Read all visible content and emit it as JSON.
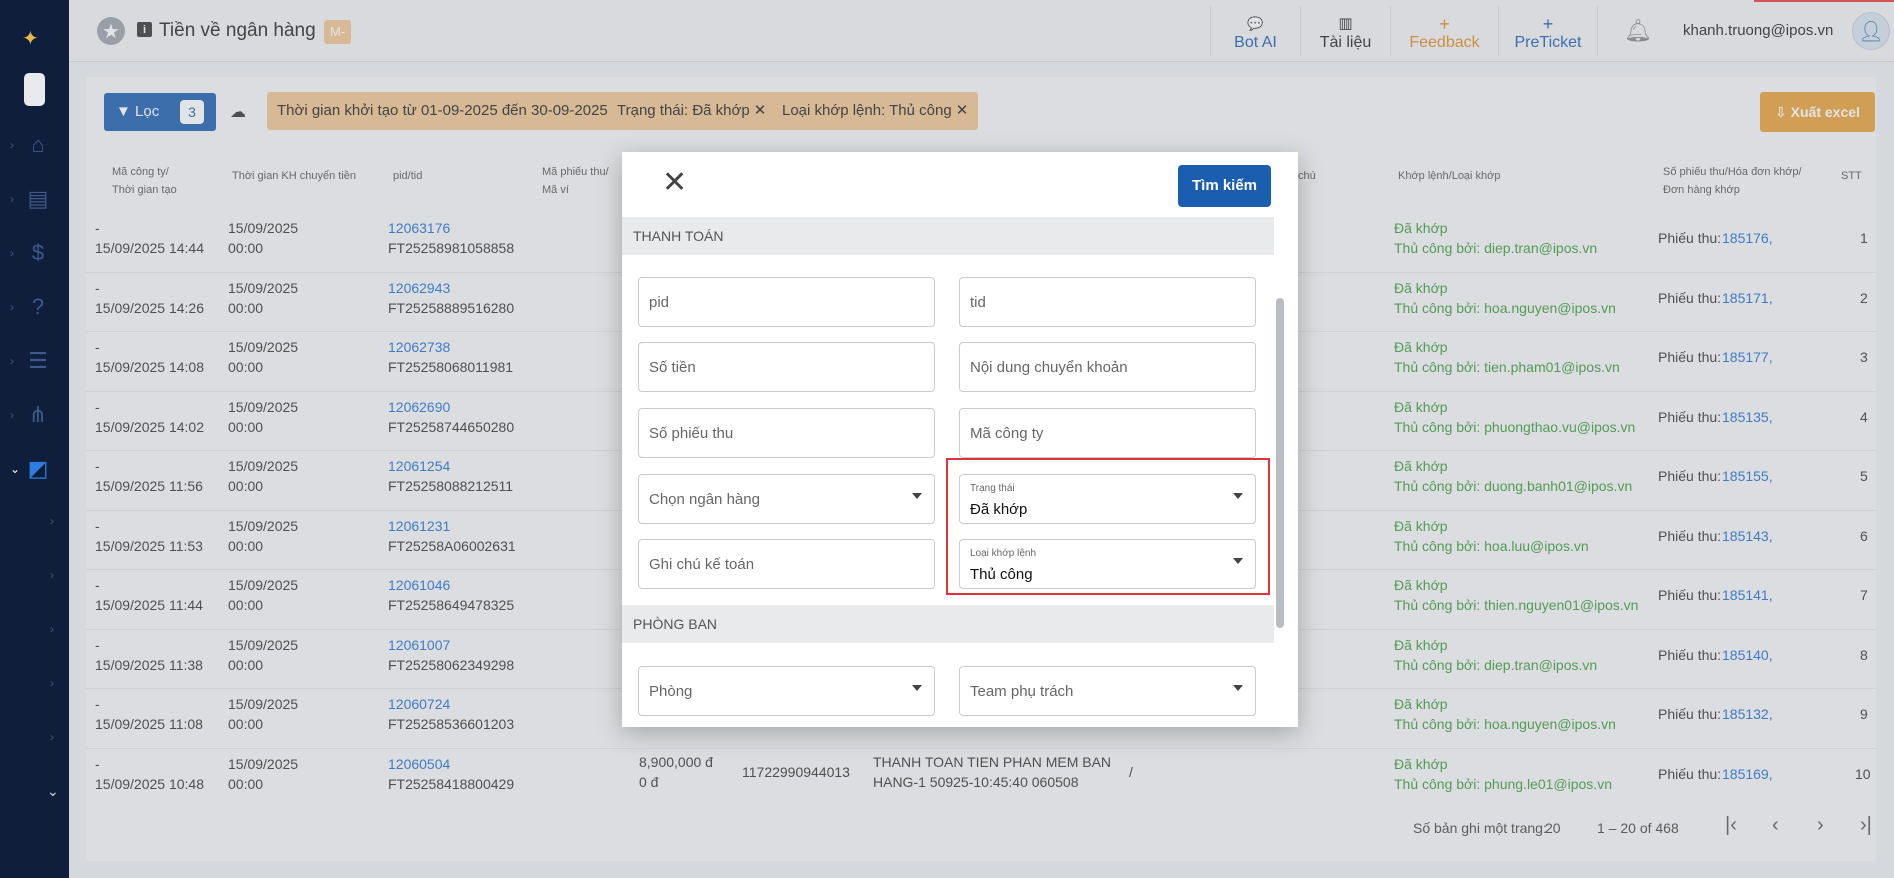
{
  "sidebar": {
    "items": [
      {
        "icon": "home-icon",
        "glyph": "⌂"
      },
      {
        "icon": "chart-icon",
        "glyph": "▤"
      },
      {
        "icon": "dollar-icon",
        "glyph": "$"
      },
      {
        "icon": "help-icon",
        "glyph": "?"
      },
      {
        "icon": "list-icon",
        "glyph": "☰"
      },
      {
        "icon": "network-icon",
        "glyph": "⋔"
      },
      {
        "icon": "report-icon",
        "glyph": "◩"
      }
    ]
  },
  "header": {
    "title": "Tiền về ngân hàng",
    "tag": "M-",
    "nav": [
      {
        "icon": "chat-icon",
        "glyph": "💬",
        "label": "Bot AI",
        "color": "#1b5eb0"
      },
      {
        "icon": "book-icon",
        "glyph": "▥",
        "label": "Tài liệu",
        "color": "#222222"
      },
      {
        "icon": "plus-icon",
        "glyph": "+",
        "label": "Feedback",
        "color": "#e08a1e"
      },
      {
        "icon": "plus-icon",
        "glyph": "+",
        "label": "PreTicket",
        "color": "#1b5eb0"
      }
    ],
    "user_email": "khanh.truong@ipos.vn"
  },
  "toolbar": {
    "filter_label": "Lọc",
    "filter_count": "3",
    "chips": [
      "Thời gian khởi tạo từ 01-09-2025 đến 30-09-2025",
      "Trạng thái: Đã khớp",
      "Loại khớp lệnh: Thủ công"
    ],
    "export_label": "Xuất excel"
  },
  "table": {
    "headers": {
      "company": [
        "Mã công ty/",
        "Thời gian tạo"
      ],
      "transfer_time": "Thời gian KH chuyển tiền",
      "pid": "pid/tid",
      "receipt": [
        "Mã phiếu thu/",
        "Mã ví"
      ],
      "note": "chú",
      "match": "Khớp lệnh/Loại khớp",
      "invoice": [
        "Số phiếu thu/Hóa đơn khớp/",
        "Đơn hàng khớp"
      ],
      "stt": "STT"
    },
    "rows": [
      {
        "c1": "-",
        "c2": "15/09/2025 14:44",
        "t1": "15/09/2025",
        "t2": "00:00",
        "pid": "12063176",
        "tid": "FT25258981058858",
        "m1": "Đã khớp",
        "m2": "Thủ công bởi: diep.tran@ipos.vn",
        "inv_label": "Phiếu thu:",
        "inv": "185176,",
        "stt": "1"
      },
      {
        "c1": "-",
        "c2": "15/09/2025 14:26",
        "t1": "15/09/2025",
        "t2": "00:00",
        "pid": "12062943",
        "tid": "FT25258889516280",
        "m1": "Đã khớp",
        "m2": "Thủ công bởi: hoa.nguyen@ipos.vn",
        "inv_label": "Phiếu thu:",
        "inv": "185171,",
        "stt": "2"
      },
      {
        "c1": "-",
        "c2": "15/09/2025 14:08",
        "t1": "15/09/2025",
        "t2": "00:00",
        "pid": "12062738",
        "tid": "FT25258068011981",
        "m1": "Đã khớp",
        "m2": "Thủ công bởi: tien.pham01@ipos.vn",
        "inv_label": "Phiếu thu:",
        "inv": "185177,",
        "stt": "3"
      },
      {
        "c1": "-",
        "c2": "15/09/2025 14:02",
        "t1": "15/09/2025",
        "t2": "00:00",
        "pid": "12062690",
        "tid": "FT25258744650280",
        "m1": "Đã khớp",
        "m2": "Thủ công bởi: phuongthao.vu@ipos.vn",
        "inv_label": "Phiếu thu:",
        "inv": "185135,",
        "stt": "4"
      },
      {
        "c1": "-",
        "c2": "15/09/2025 11:56",
        "t1": "15/09/2025",
        "t2": "00:00",
        "pid": "12061254",
        "tid": "FT25258088212511",
        "m1": "Đã khớp",
        "m2": "Thủ công bởi: duong.banh01@ipos.vn",
        "inv_label": "Phiếu thu:",
        "inv": "185155,",
        "stt": "5"
      },
      {
        "c1": "-",
        "c2": "15/09/2025 11:53",
        "t1": "15/09/2025",
        "t2": "00:00",
        "pid": "12061231",
        "tid": "FT25258A06002631",
        "m1": "Đã khớp",
        "m2": "Thủ công bởi: hoa.luu@ipos.vn",
        "inv_label": "Phiếu thu:",
        "inv": "185143,",
        "stt": "6"
      },
      {
        "c1": "-",
        "c2": "15/09/2025 11:44",
        "t1": "15/09/2025",
        "t2": "00:00",
        "pid": "12061046",
        "tid": "FT25258649478325",
        "m1": "Đã khớp",
        "m2": "Thủ công bởi: thien.nguyen01@ipos.vn",
        "inv_label": "Phiếu thu:",
        "inv": "185141,",
        "stt": "7"
      },
      {
        "c1": "-",
        "c2": "15/09/2025 11:38",
        "t1": "15/09/2025",
        "t2": "00:00",
        "pid": "12061007",
        "tid": "FT25258062349298",
        "m1": "Đã khớp",
        "m2": "Thủ công bởi: diep.tran@ipos.vn",
        "inv_label": "Phiếu thu:",
        "inv": "185140,",
        "stt": "8"
      },
      {
        "c1": "-",
        "c2": "15/09/2025 11:08",
        "t1": "15/09/2025",
        "t2": "00:00",
        "pid": "12060724",
        "tid": "FT25258536601203",
        "m1": "Đã khớp",
        "m2": "Thủ công bởi: hoa.nguyen@ipos.vn",
        "inv_label": "Phiếu thu:",
        "inv": "185132,",
        "stt": "9"
      },
      {
        "c1": "-",
        "c2": "15/09/2025 10:48",
        "t1": "15/09/2025",
        "t2": "00:00",
        "pid": "12060504",
        "tid": "FT25258418800429",
        "m1": "Đã khớp",
        "m2": "Thủ công bởi: phung.le01@ipos.vn",
        "inv_label": "Phiếu thu:",
        "inv": "185169,",
        "stt": "10"
      }
    ],
    "row10_extra": {
      "amount": "8,900,000 đ",
      "fee": "0 đ",
      "account": "11722990944013",
      "content_1": "THANH TOAN TIEN PHAN MEM BAN",
      "content_2": "HANG-1 50925-10:45:40 060508",
      "slash": "/"
    }
  },
  "pager": {
    "per_page_label": "Số bản ghi một trang:",
    "per_page": "20",
    "range": "1 – 20 of 468"
  },
  "modal": {
    "search_label": "Tìm kiếm",
    "section_payment": "THANH TOÁN",
    "section_dept": "PHÒNG BAN",
    "fields": {
      "pid": "pid",
      "tid": "tid",
      "amount": "Số tiền",
      "transfer_content": "Nội dung chuyển khoản",
      "receipt_no": "Số phiếu thu",
      "company_code": "Mã công ty",
      "bank": "Chọn ngân hàng",
      "status_label": "Trạng thái",
      "status_value": "Đã khớp",
      "accounting_note": "Ghi chú kế toán",
      "match_type_label": "Loại khớp lệnh",
      "match_type_value": "Thủ công",
      "department": "Phòng",
      "team": "Team phụ trách"
    }
  },
  "colors": {
    "primary": "#1b5eb0",
    "accent": "#e8a038",
    "chip": "#f2c592",
    "matched": "#3b9a3b",
    "highlight": "#e0333a"
  }
}
